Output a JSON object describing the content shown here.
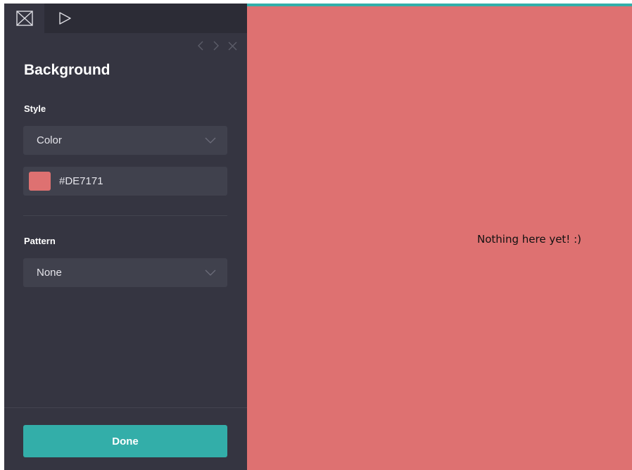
{
  "tabs": [
    {
      "icon": "layout-box-icon",
      "active": true
    },
    {
      "icon": "play-icon",
      "active": false
    }
  ],
  "nav": {
    "prev_icon": "chevron-left-icon",
    "next_icon": "chevron-right-icon",
    "close_icon": "close-icon"
  },
  "panel": {
    "title": "Background",
    "style_label": "Style",
    "style_value": "Color",
    "color_value": "#DE7171",
    "pattern_label": "Pattern",
    "pattern_value": "None",
    "done_label": "Done"
  },
  "preview": {
    "empty_message": "Nothing here yet! :)"
  },
  "colors": {
    "sidebar_bg": "#353541",
    "accent": "#33aea9",
    "preview_bg": "#DE7171"
  }
}
